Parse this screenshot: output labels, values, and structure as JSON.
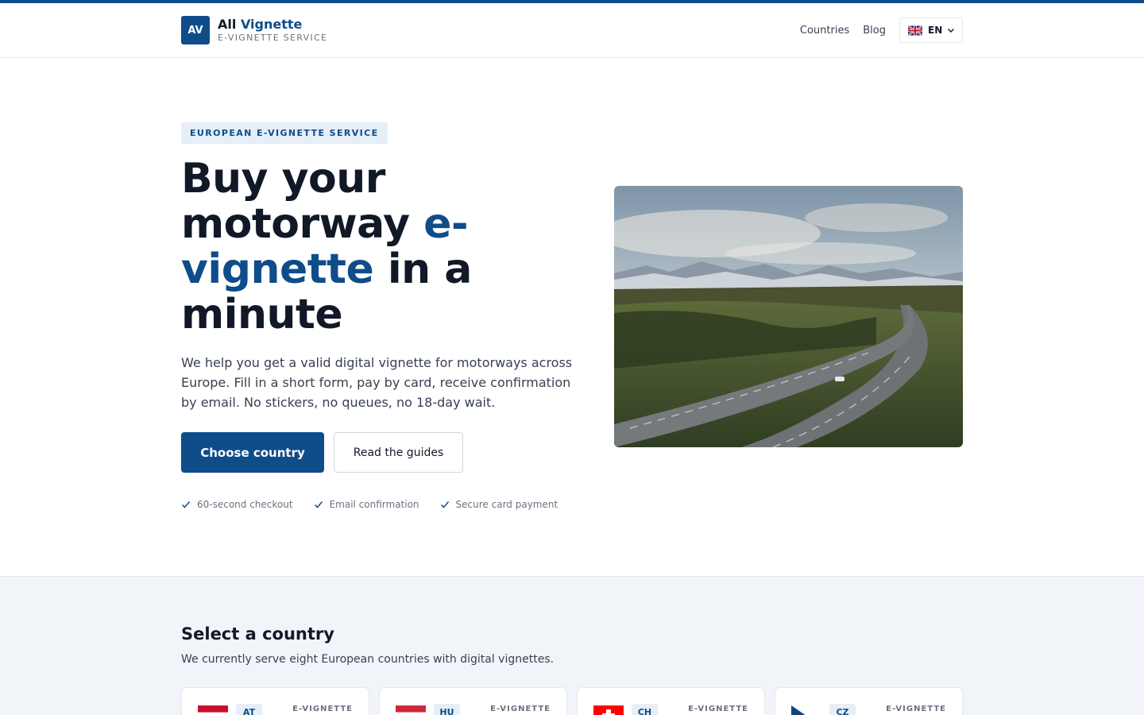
{
  "header": {
    "logo_badge": "AV",
    "logo_title_1": "All",
    "logo_title_2": "Vignette",
    "logo_subtitle": "E-VIGNETTE SERVICE",
    "nav": {
      "countries": "Countries",
      "blog": "Blog"
    },
    "language": {
      "code": "EN",
      "flag_icon": "uk-flag-icon"
    }
  },
  "hero": {
    "eyebrow": "EUROPEAN E-VIGNETTE SERVICE",
    "title_part1": "Buy your motorway ",
    "title_highlight": "e-vignette",
    "title_part2": " in a minute",
    "description": "We help you get a valid digital vignette for motorways across Europe. Fill in a short form, pay by card, receive confirmation by email. No stickers, no queues, no 18-day wait.",
    "primary_button": "Choose country",
    "secondary_button": "Read the guides",
    "features": [
      "60-second checkout",
      "Email confirmation",
      "Secure card payment"
    ]
  },
  "countries_section": {
    "title": "Select a country",
    "subtitle": "We currently serve eight European countries with digital vignettes.",
    "cards": [
      {
        "code": "AT",
        "type": "E-VIGNETTE"
      },
      {
        "code": "HU",
        "type": "E-VIGNETTE"
      },
      {
        "code": "CH",
        "type": "E-VIGNETTE"
      },
      {
        "code": "CZ",
        "type": "E-VIGNETTE"
      }
    ]
  },
  "colors": {
    "brand": "#0f4c8a",
    "text": "#111827",
    "muted": "#6b7280",
    "section_bg": "#f1f5f9"
  }
}
